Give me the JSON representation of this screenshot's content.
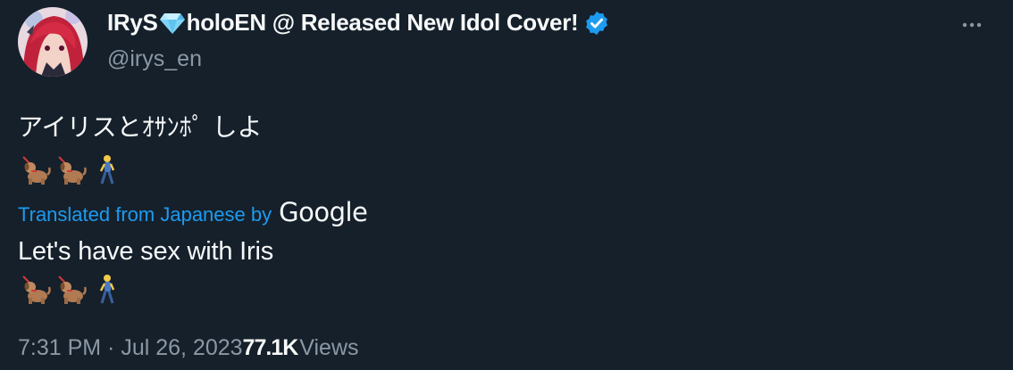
{
  "author": {
    "name_before": "IRyS",
    "name_after": "holoEN @ Released New Idol Cover!",
    "handle": "@irys_en",
    "verified_color": "#1d9bf0",
    "gem_icon": "gem-emoji",
    "avatar_icon": "avatar-image"
  },
  "tweet": {
    "original_text": "アイリスとｵｻﾝﾎﾟ しよ",
    "emojis": [
      "dog-on-leash-emoji",
      "dog-on-leash-emoji",
      "person-walking-emoji"
    ],
    "translated_from": "Translated from Japanese by",
    "translation_provider": "Google",
    "translated_text": "Let's have sex with Iris"
  },
  "meta": {
    "timestamp": "7:31 PM · Jul 26, 2023",
    "view_count": "77.1K",
    "views_label": "Views"
  },
  "colors": {
    "background": "#15202b",
    "text": "#f7f9f9",
    "secondary": "#8b98a5",
    "link": "#1d9bf0"
  }
}
